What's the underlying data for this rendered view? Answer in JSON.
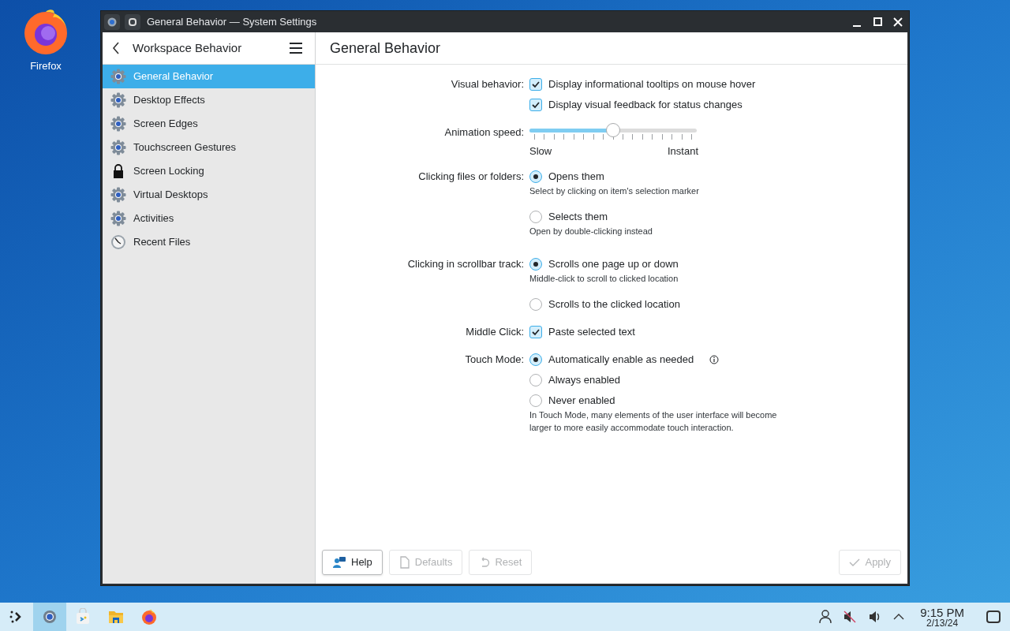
{
  "desktop_icons": [
    {
      "label": "Firefox"
    }
  ],
  "window": {
    "title": "General Behavior — System Settings"
  },
  "sidebar": {
    "title": "Workspace Behavior",
    "items": [
      {
        "label": "General Behavior",
        "kind": "gear",
        "selected": true
      },
      {
        "label": "Desktop Effects",
        "kind": "gear",
        "selected": false
      },
      {
        "label": "Screen Edges",
        "kind": "gear",
        "selected": false
      },
      {
        "label": "Touchscreen Gestures",
        "kind": "gear",
        "selected": false
      },
      {
        "label": "Screen Locking",
        "kind": "lock",
        "selected": false
      },
      {
        "label": "Virtual Desktops",
        "kind": "gear",
        "selected": false
      },
      {
        "label": "Activities",
        "kind": "gear",
        "selected": false
      },
      {
        "label": "Recent Files",
        "kind": "clock",
        "selected": false
      }
    ]
  },
  "page": {
    "title": "General Behavior",
    "settings": [
      {
        "label": "Visual behavior:",
        "options": [
          {
            "kind": "checkbox",
            "label": "Display informational tooltips on mouse hover",
            "checked": true
          },
          {
            "kind": "checkbox",
            "label": "Display visual feedback for status changes",
            "checked": true
          }
        ]
      },
      {
        "label": "Animation speed:",
        "options": [
          {
            "kind": "slider",
            "level": 0.5,
            "min_label": "Slow",
            "max_label": "Instant"
          }
        ]
      },
      {
        "label": "Clicking files or folders:",
        "options": [
          {
            "kind": "radio",
            "label": "Opens them",
            "selected": true,
            "hint": "Select by clicking on item's selection marker"
          },
          {
            "kind": "radio",
            "label": "Selects them",
            "selected": false,
            "hint": "Open by double-clicking instead"
          }
        ]
      },
      {
        "label": "Clicking in scrollbar track:",
        "options": [
          {
            "kind": "radio",
            "label": "Scrolls one page up or down",
            "selected": true,
            "hint": "Middle-click to scroll to clicked location"
          },
          {
            "kind": "radio",
            "label": "Scrolls to the clicked location",
            "selected": false
          }
        ]
      },
      {
        "label": "Middle Click:",
        "options": [
          {
            "kind": "checkbox",
            "label": "Paste selected text",
            "checked": true
          }
        ]
      },
      {
        "label": "Touch Mode:",
        "options": [
          {
            "kind": "radio",
            "label": "Automatically enable as needed",
            "selected": true,
            "info": true
          },
          {
            "kind": "radio",
            "label": "Always enabled",
            "selected": false
          },
          {
            "kind": "radio",
            "label": "Never enabled",
            "selected": false,
            "hint": "In Touch Mode, many elements of the user interface will become larger to more easily accommodate touch interaction."
          }
        ]
      }
    ]
  },
  "buttons": [
    {
      "label": "Help",
      "kind": "help",
      "disabled": false
    },
    {
      "label": "Defaults",
      "kind": "defaults",
      "disabled": true
    },
    {
      "label": "Reset",
      "kind": "reset",
      "disabled": true
    },
    {
      "label": "Apply",
      "kind": "apply",
      "disabled": true
    }
  ],
  "taskbar": {
    "items": [
      {
        "kind": "launcher",
        "selected": false
      },
      {
        "kind": "settings",
        "selected": true
      },
      {
        "kind": "store",
        "selected": false
      },
      {
        "kind": "folder",
        "selected": false
      },
      {
        "kind": "firefox",
        "selected": false
      }
    ],
    "clock": {
      "time": "9:15 PM",
      "date": "2/13/24"
    }
  }
}
